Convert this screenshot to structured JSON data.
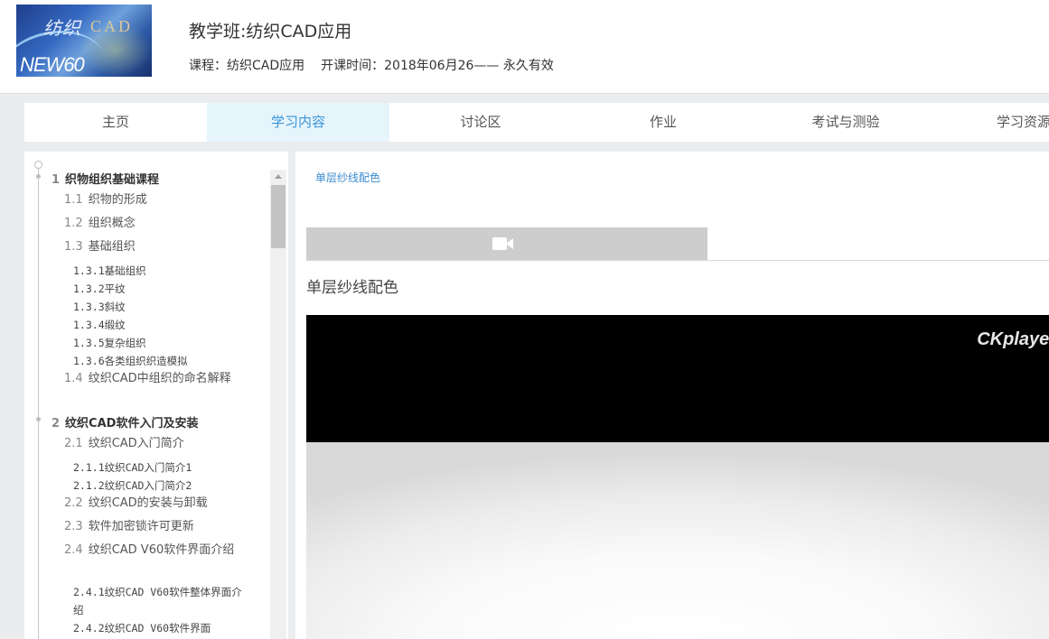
{
  "header": {
    "logo": {
      "text_cn": "纺织",
      "text_cad": "CAD",
      "brand": "NEW60"
    },
    "title": "教学班:纺织CAD应用",
    "course_label": "课程：纺织CAD应用",
    "start_label": "开课时间：2018年06月26—— 永久有效"
  },
  "nav": {
    "tabs": [
      {
        "label": "主页",
        "active": false
      },
      {
        "label": "学习内容",
        "active": true
      },
      {
        "label": "讨论区",
        "active": false
      },
      {
        "label": "作业",
        "active": false
      },
      {
        "label": "考试与测验",
        "active": false
      },
      {
        "label": "学习资源",
        "active": false
      }
    ]
  },
  "sidebar": {
    "items": [
      {
        "num": "1",
        "label": "织物组织基础课程",
        "level": 1
      },
      {
        "num": "1.1",
        "label": "织物的形成",
        "level": 2
      },
      {
        "num": "1.2",
        "label": "组织概念",
        "level": 2
      },
      {
        "num": "1.3",
        "label": "基础组织",
        "level": 2
      },
      {
        "num": "",
        "label": "1.3.1基础组织",
        "level": 3
      },
      {
        "num": "",
        "label": "1.3.2平纹",
        "level": 3
      },
      {
        "num": "",
        "label": "1.3.3斜纹",
        "level": 3
      },
      {
        "num": "",
        "label": "1.3.4缎纹",
        "level": 3
      },
      {
        "num": "",
        "label": "1.3.5复杂组织",
        "level": 3
      },
      {
        "num": "",
        "label": "1.3.6各类组织织造模拟",
        "level": 3
      },
      {
        "num": "1.4",
        "label": "纹织CAD中组织的命名解释",
        "level": 2
      },
      {
        "num": "2",
        "label": "纹织CAD软件入门及安装",
        "level": 1
      },
      {
        "num": "2.1",
        "label": "纹织CAD入门简介",
        "level": 2
      },
      {
        "num": "",
        "label": "2.1.1纹织CAD入门简介1",
        "level": 3
      },
      {
        "num": "",
        "label": "2.1.2纹织CAD入门简介2",
        "level": 3
      },
      {
        "num": "2.2",
        "label": "纹织CAD的安装与卸载",
        "level": 2
      },
      {
        "num": "2.3",
        "label": "软件加密锁许可更新",
        "level": 2
      },
      {
        "num": "2.4",
        "label": "纹织CAD V60软件界面介绍",
        "level": 2
      },
      {
        "num": "",
        "label": "2.4.1纹织CAD V60软件整体界面介绍",
        "level": 3
      },
      {
        "num": "",
        "label": "2.4.2纹织CAD V60软件界面",
        "level": 3
      }
    ]
  },
  "main": {
    "breadcrumb": "单层纱线配色",
    "media_tab_icon": "video-camera-icon",
    "section_title": "单层纱线配色",
    "player_brand": "CKplayer"
  },
  "colors": {
    "accent": "#3a95d6",
    "active_tab_bg": "#e6f4fc",
    "media_tab_bg": "#cdcdcd",
    "page_bg": "#ebecee"
  }
}
